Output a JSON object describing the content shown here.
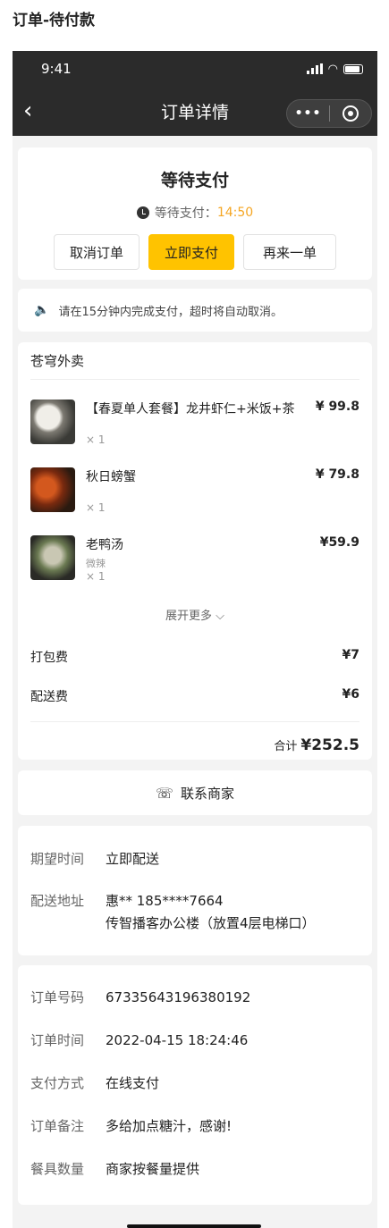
{
  "page_label": "订单-待付款",
  "status_bar": {
    "time": "9:41"
  },
  "navbar": {
    "title": "订单详情",
    "back": "‹",
    "more": "•••"
  },
  "order_status": {
    "title": "等待支付",
    "countdown_label": "等待支付：",
    "countdown_time": "14:50",
    "buttons": {
      "cancel": "取消订单",
      "pay": "立即支付",
      "again": "再来一单"
    }
  },
  "notice": {
    "text": "请在15分钟内完成支付，超时将自动取消。"
  },
  "goods": {
    "shop_name": "苍穹外卖",
    "items": [
      {
        "name": "【春夏单人套餐】龙井虾仁+米饭+茶",
        "spec": "",
        "qty": "× 1",
        "price": "¥ 99.8"
      },
      {
        "name": "秋日螃蟹",
        "spec": "",
        "qty": "× 1",
        "price": "¥ 79.8"
      },
      {
        "name": "老鸭汤",
        "spec": "微辣",
        "qty": "× 1",
        "price": "¥59.9"
      }
    ],
    "expand": "展开更多 ⌵",
    "packing_fee_label": "打包费",
    "packing_fee": "¥7",
    "delivery_fee_label": "配送费",
    "delivery_fee": "¥6",
    "total_label": "合计",
    "total": "¥252.5"
  },
  "contact": {
    "label": "联系商家"
  },
  "delivery": {
    "expect_label": "期望时间",
    "expect_value": "立即配送",
    "address_label": "配送地址",
    "address_line1": "惠** 185****7664",
    "address_line2": "传智播客办公楼（放置4层电梯口）"
  },
  "order_info": {
    "number_label": "订单号码",
    "number": "67335643196380192",
    "time_label": "订单时间",
    "time": "2022-04-15 18:24:46",
    "pay_label": "支付方式",
    "pay": "在线支付",
    "remark_label": "订单备注",
    "remark": "多给加点糖汁，感谢!",
    "tableware_label": "餐具数量",
    "tableware": "商家按餐量提供"
  },
  "colors": {
    "accent": "#ffc300",
    "countdown": "#f5a623",
    "header": "#2b2b2b"
  }
}
